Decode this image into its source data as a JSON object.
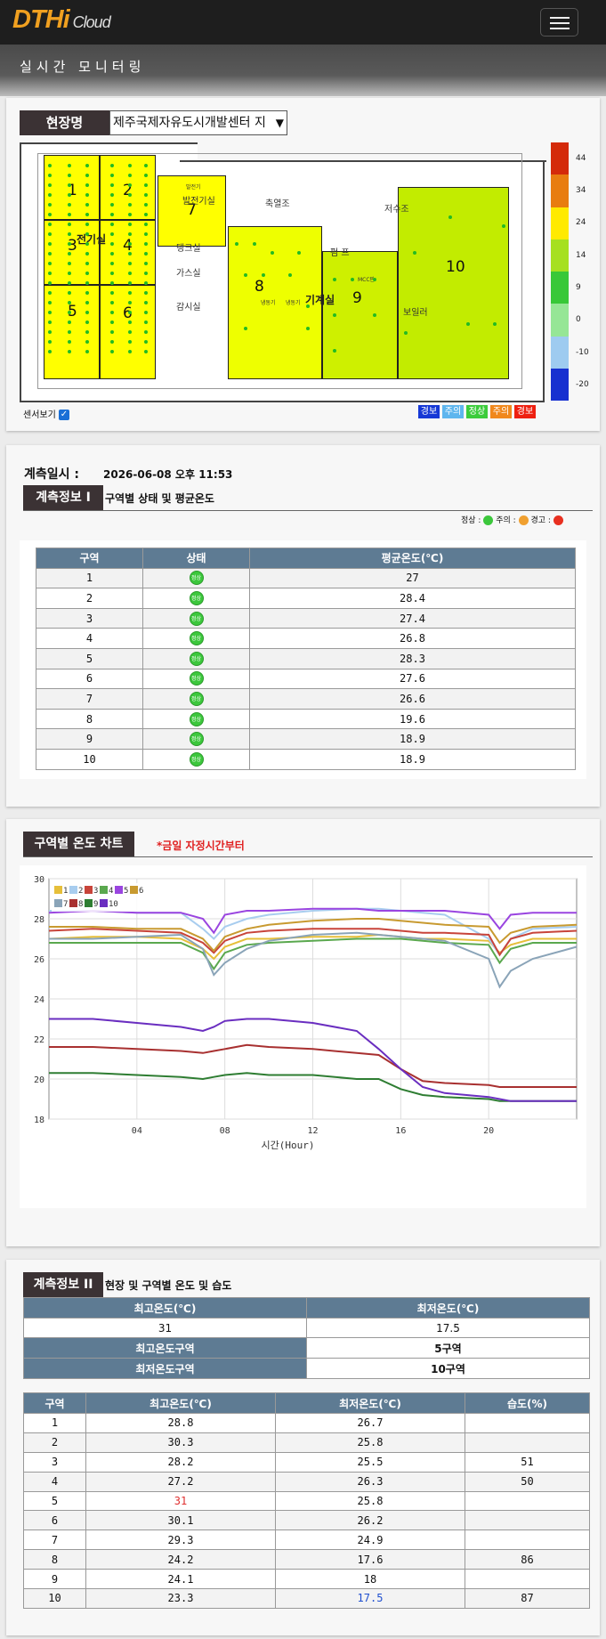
{
  "nav": {
    "logo_main": "DTHi",
    "logo_sub": "Cloud"
  },
  "page": {
    "title": "실시간 모니터링"
  },
  "site": {
    "label": "현장명",
    "selected": "제주국제자유도시개발센터 지",
    "labels": {
      "ec": "전기실",
      "gen_room": "발전기실",
      "gen_tag": "발전기",
      "tank": "탱크실",
      "gas": "가스실",
      "filter": "감시실",
      "mech": "기계실",
      "cool": "축열조",
      "water": "저수조",
      "pump": "펌 프",
      "mcc": "MCC판",
      "boiler": "보일러",
      "cooler1": "냉동기",
      "cooler2": "냉동기"
    },
    "zones": [
      "1",
      "2",
      "3",
      "4",
      "5",
      "6",
      "7",
      "8",
      "9",
      "10"
    ],
    "scale": [
      "44",
      "34",
      "24",
      "14",
      "9",
      "0",
      "-10",
      "-20"
    ],
    "scale_colors": [
      "#d42a0a",
      "#e87d10",
      "#ffea00",
      "#a6e020",
      "#38c838",
      "#96e696",
      "#9ecbf0",
      "#1730d0"
    ],
    "sensor_view": "센서보기",
    "legend": [
      {
        "t": "경보",
        "c": "#1638d6"
      },
      {
        "t": "주의",
        "c": "#5fb6ee"
      },
      {
        "t": "정상",
        "c": "#3ccc3c"
      },
      {
        "t": "주의",
        "c": "#f0881c"
      },
      {
        "t": "경보",
        "c": "#ee2010"
      }
    ]
  },
  "measure": {
    "time_label": "계측일시 :",
    "time_value": "2026-06-08 오후 11:53",
    "header": "계측정보 I",
    "subtitle": "구역별 상태 및 평균온도",
    "status_legend": {
      "normal": "정상 :",
      "caution": "주의 :",
      "warn": "경고 :"
    },
    "columns": [
      "구역",
      "상태",
      "평균온도(℃)"
    ],
    "status_icon": "정상",
    "rows": [
      {
        "zone": "1",
        "avg": "27"
      },
      {
        "zone": "2",
        "avg": "28.4"
      },
      {
        "zone": "3",
        "avg": "27.4"
      },
      {
        "zone": "4",
        "avg": "26.8"
      },
      {
        "zone": "5",
        "avg": "28.3"
      },
      {
        "zone": "6",
        "avg": "27.6"
      },
      {
        "zone": "7",
        "avg": "26.6"
      },
      {
        "zone": "8",
        "avg": "19.6"
      },
      {
        "zone": "9",
        "avg": "18.9"
      },
      {
        "zone": "10",
        "avg": "18.9"
      }
    ]
  },
  "chart": {
    "header": "구역별 온도 차트",
    "note": "*금일 자정시간부터"
  },
  "chart_data": {
    "type": "line",
    "xlabel": "시간(Hour)",
    "ylabel": "",
    "xlim": [
      0,
      24
    ],
    "ylim": [
      18,
      30
    ],
    "x_ticks": [
      "04",
      "08",
      "12",
      "16",
      "20"
    ],
    "y_ticks": [
      "18",
      "20",
      "22",
      "24",
      "26",
      "28",
      "30"
    ],
    "grid": true,
    "legend_position": "top-left",
    "x": [
      0,
      2,
      4,
      6,
      7,
      7.5,
      8,
      9,
      10,
      12,
      14,
      15,
      16,
      17,
      18,
      20,
      20.5,
      21,
      22,
      24
    ],
    "series": [
      {
        "name": "1",
        "color": "#e6bf3a",
        "values": [
          27.0,
          27.1,
          27.1,
          27.0,
          26.5,
          26.0,
          26.6,
          27.0,
          27.0,
          27.1,
          27.1,
          27.2,
          27.1,
          27.0,
          27.0,
          26.9,
          26.3,
          26.7,
          27.0,
          27.0
        ]
      },
      {
        "name": "2",
        "color": "#a8cdef",
        "values": [
          28.4,
          28.4,
          28.3,
          28.3,
          27.5,
          27.0,
          27.6,
          28.0,
          28.2,
          28.4,
          28.5,
          28.5,
          28.4,
          28.3,
          28.2,
          27.0,
          26.2,
          27.0,
          27.5,
          27.6
        ]
      },
      {
        "name": "3",
        "color": "#c8443a",
        "values": [
          27.4,
          27.5,
          27.4,
          27.3,
          26.8,
          26.3,
          26.9,
          27.3,
          27.4,
          27.5,
          27.5,
          27.5,
          27.4,
          27.3,
          27.3,
          27.2,
          26.2,
          27.0,
          27.3,
          27.4
        ]
      },
      {
        "name": "4",
        "color": "#5aa84e",
        "values": [
          26.8,
          26.8,
          26.8,
          26.8,
          26.3,
          25.5,
          26.3,
          26.7,
          26.8,
          26.9,
          27.0,
          27.0,
          27.0,
          26.9,
          26.8,
          26.7,
          25.8,
          26.5,
          26.8,
          26.8
        ]
      },
      {
        "name": "5",
        "color": "#9a45e0",
        "values": [
          28.3,
          28.4,
          28.3,
          28.3,
          28.0,
          27.3,
          28.2,
          28.4,
          28.4,
          28.5,
          28.5,
          28.4,
          28.4,
          28.4,
          28.4,
          28.2,
          27.5,
          28.2,
          28.3,
          28.3
        ]
      },
      {
        "name": "6",
        "color": "#c89a30",
        "values": [
          27.6,
          27.6,
          27.5,
          27.5,
          27.0,
          26.4,
          27.1,
          27.5,
          27.7,
          27.9,
          28.0,
          28.0,
          27.9,
          27.8,
          27.7,
          27.6,
          26.8,
          27.3,
          27.6,
          27.7
        ]
      },
      {
        "name": "7",
        "color": "#8aa4b8",
        "values": [
          27.0,
          27.0,
          27.1,
          27.2,
          26.5,
          25.2,
          25.8,
          26.5,
          26.9,
          27.2,
          27.3,
          27.2,
          27.1,
          27.0,
          26.9,
          26.0,
          24.6,
          25.4,
          26.0,
          26.6
        ]
      },
      {
        "name": "8",
        "color": "#a83030",
        "values": [
          21.6,
          21.6,
          21.5,
          21.4,
          21.3,
          21.4,
          21.5,
          21.7,
          21.6,
          21.5,
          21.3,
          21.2,
          20.5,
          19.9,
          19.8,
          19.7,
          19.6,
          19.6,
          19.6,
          19.6
        ]
      },
      {
        "name": "9",
        "color": "#2e7d32",
        "values": [
          20.3,
          20.3,
          20.2,
          20.1,
          20.0,
          20.1,
          20.2,
          20.3,
          20.2,
          20.2,
          20.0,
          20.0,
          19.5,
          19.2,
          19.1,
          19.0,
          18.9,
          18.9,
          18.9,
          18.9
        ]
      },
      {
        "name": "10",
        "color": "#6a2ec0",
        "values": [
          23.0,
          23.0,
          22.8,
          22.6,
          22.4,
          22.6,
          22.9,
          23.0,
          23.0,
          22.8,
          22.4,
          21.5,
          20.5,
          19.6,
          19.3,
          19.1,
          19.0,
          18.9,
          18.9,
          18.9
        ]
      }
    ]
  },
  "info2": {
    "header": "계측정보 II",
    "subtitle": "현장 및 구역별 온도 및 습도",
    "max_label": "최고온도(℃)",
    "min_label": "최저온도(℃)",
    "max_value": "31",
    "min_value": "17.5",
    "max_zone_label": "최고온도구역",
    "max_zone": "5구역",
    "min_zone_label": "최저온도구역",
    "min_zone": "10구역",
    "columns": [
      "구역",
      "최고온도(℃)",
      "최저온도(℃)",
      "습도(%)"
    ],
    "rows": [
      {
        "zone": "1",
        "max": "28.8",
        "min": "26.7",
        "hum": ""
      },
      {
        "zone": "2",
        "max": "30.3",
        "min": "25.8",
        "hum": ""
      },
      {
        "zone": "3",
        "max": "28.2",
        "min": "25.5",
        "hum": "51"
      },
      {
        "zone": "4",
        "max": "27.2",
        "min": "26.3",
        "hum": "50"
      },
      {
        "zone": "5",
        "max": "31",
        "min": "25.8",
        "hum": ""
      },
      {
        "zone": "6",
        "max": "30.1",
        "min": "26.2",
        "hum": ""
      },
      {
        "zone": "7",
        "max": "29.3",
        "min": "24.9",
        "hum": ""
      },
      {
        "zone": "8",
        "max": "24.2",
        "min": "17.6",
        "hum": "86"
      },
      {
        "zone": "9",
        "max": "24.1",
        "min": "18",
        "hum": ""
      },
      {
        "zone": "10",
        "max": "23.3",
        "min": "17.5",
        "hum": "87"
      }
    ]
  }
}
